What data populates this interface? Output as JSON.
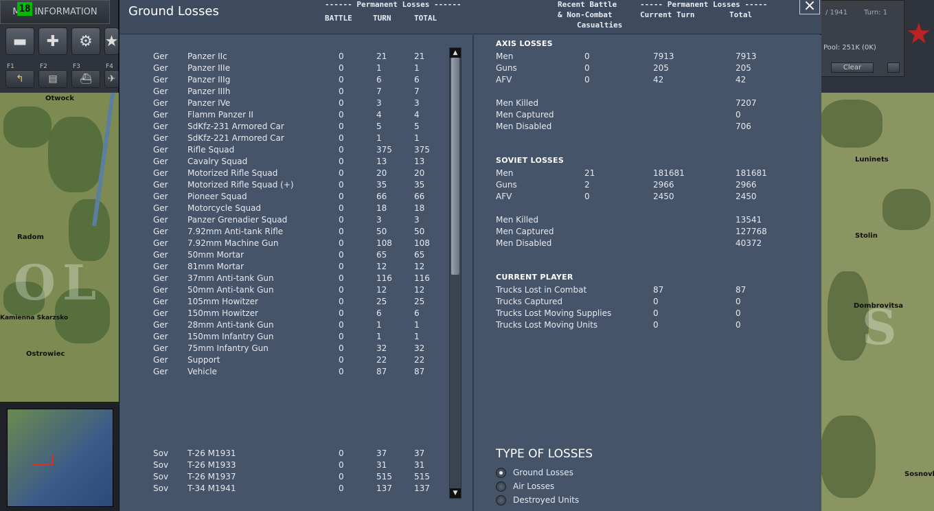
{
  "left_panel": {
    "turn_digit": "18",
    "map_info_tab": "MAP INFORMATION",
    "fkeys": [
      "F1",
      "F2",
      "F3",
      "F4"
    ],
    "map_towns": [
      "Otwock",
      "Radom",
      "Kamienna Skarzsko",
      "Ostrowiec"
    ]
  },
  "right_panel": {
    "date": "/ 1941",
    "turn": "Turn: 1",
    "pool": "Pool: 251K (0K)",
    "clear_label": "Clear",
    "map_towns": [
      "Luninets",
      "Stolin",
      "Dombrovitsa",
      "Sosnovka"
    ]
  },
  "dialog": {
    "title": "Ground Losses",
    "close_label": "×",
    "left_header": {
      "group": "------ Permanent Losses ------",
      "battle": "BATTLE",
      "turn": "TURN",
      "total": "TOTAL"
    },
    "right_header": {
      "recent_line1": "Recent Battle",
      "recent_line2": "& Non-Combat",
      "recent_line3": "Casualties",
      "group": "----- Permanent Losses -----",
      "current_turn": "Current Turn",
      "total": "Total"
    },
    "ger_units": [
      [
        "Ger",
        "Panzer IIc",
        "0",
        "21",
        "21"
      ],
      [
        "Ger",
        "Panzer IIIe",
        "0",
        "1",
        "1"
      ],
      [
        "Ger",
        "Panzer IIIg",
        "0",
        "6",
        "6"
      ],
      [
        "Ger",
        "Panzer IIIh",
        "0",
        "7",
        "7"
      ],
      [
        "Ger",
        "Panzer IVe",
        "0",
        "3",
        "3"
      ],
      [
        "Ger",
        "Flamm Panzer II",
        "0",
        "4",
        "4"
      ],
      [
        "Ger",
        "SdKfz-231 Armored Car",
        "0",
        "5",
        "5"
      ],
      [
        "Ger",
        "SdKfz-221 Armored Car",
        "0",
        "1",
        "1"
      ],
      [
        "Ger",
        "Rifle Squad",
        "0",
        "375",
        "375"
      ],
      [
        "Ger",
        "Cavalry Squad",
        "0",
        "13",
        "13"
      ],
      [
        "Ger",
        "Motorized Rifle Squad",
        "0",
        "20",
        "20"
      ],
      [
        "Ger",
        "Motorized Rifle Squad (+)",
        "0",
        "35",
        "35"
      ],
      [
        "Ger",
        "Pioneer Squad",
        "0",
        "66",
        "66"
      ],
      [
        "Ger",
        "Motorcycle Squad",
        "0",
        "18",
        "18"
      ],
      [
        "Ger",
        "Panzer Grenadier Squad",
        "0",
        "3",
        "3"
      ],
      [
        "Ger",
        "7.92mm Anti-tank Rifle",
        "0",
        "50",
        "50"
      ],
      [
        "Ger",
        "7.92mm Machine Gun",
        "0",
        "108",
        "108"
      ],
      [
        "Ger",
        "50mm Mortar",
        "0",
        "65",
        "65"
      ],
      [
        "Ger",
        "81mm Mortar",
        "0",
        "12",
        "12"
      ],
      [
        "Ger",
        "37mm Anti-tank Gun",
        "0",
        "116",
        "116"
      ],
      [
        "Ger",
        "50mm Anti-tank Gun",
        "0",
        "12",
        "12"
      ],
      [
        "Ger",
        "105mm Howitzer",
        "0",
        "25",
        "25"
      ],
      [
        "Ger",
        "150mm Howitzer",
        "0",
        "6",
        "6"
      ],
      [
        "Ger",
        "28mm Anti-tank Gun",
        "0",
        "1",
        "1"
      ],
      [
        "Ger",
        "150mm Infantry Gun",
        "0",
        "1",
        "1"
      ],
      [
        "Ger",
        "75mm Infantry Gun",
        "0",
        "32",
        "32"
      ],
      [
        "Ger",
        "Support",
        "0",
        "22",
        "22"
      ],
      [
        "Ger",
        "Vehicle",
        "0",
        "87",
        "87"
      ]
    ],
    "sov_units": [
      [
        "Sov",
        "T-26 M1931",
        "0",
        "37",
        "37"
      ],
      [
        "Sov",
        "T-26 M1933",
        "0",
        "31",
        "31"
      ],
      [
        "Sov",
        "T-26 M1937",
        "0",
        "515",
        "515"
      ],
      [
        "Sov",
        "T-34 M1941",
        "0",
        "137",
        "137"
      ]
    ],
    "axis": {
      "title": "AXIS LOSSES",
      "rows": [
        [
          "Men",
          "0",
          "7913",
          "7913"
        ],
        [
          "Guns",
          "0",
          "205",
          "205"
        ],
        [
          "AFV",
          "0",
          "42",
          "42"
        ]
      ],
      "detail": [
        [
          "Men Killed",
          "7207"
        ],
        [
          "Men Captured",
          "0"
        ],
        [
          "Men Disabled",
          "706"
        ]
      ]
    },
    "soviet": {
      "title": "SOVIET LOSSES",
      "rows": [
        [
          "Men",
          "21",
          "181681",
          "181681"
        ],
        [
          "Guns",
          "2",
          "2966",
          "2966"
        ],
        [
          "AFV",
          "0",
          "2450",
          "2450"
        ]
      ],
      "detail": [
        [
          "Men Killed",
          "13541"
        ],
        [
          "Men Captured",
          "127768"
        ],
        [
          "Men Disabled",
          "40372"
        ]
      ]
    },
    "current_player": {
      "title": "CURRENT PLAYER",
      "rows": [
        [
          "Trucks Lost in Combat",
          "87",
          "87"
        ],
        [
          "Trucks Captured",
          "0",
          "0"
        ],
        [
          "Trucks Lost Moving Supplies",
          "0",
          "0"
        ],
        [
          "Trucks Lost Moving Units",
          "0",
          "0"
        ]
      ]
    },
    "type_of_losses": {
      "title": "TYPE OF LOSSES",
      "options": [
        "Ground Losses",
        "Air Losses",
        "Destroyed Units"
      ],
      "selected": "Ground Losses"
    }
  },
  "colors": {
    "dialog_bg": "#46546a",
    "text": "#e6e9ee"
  }
}
